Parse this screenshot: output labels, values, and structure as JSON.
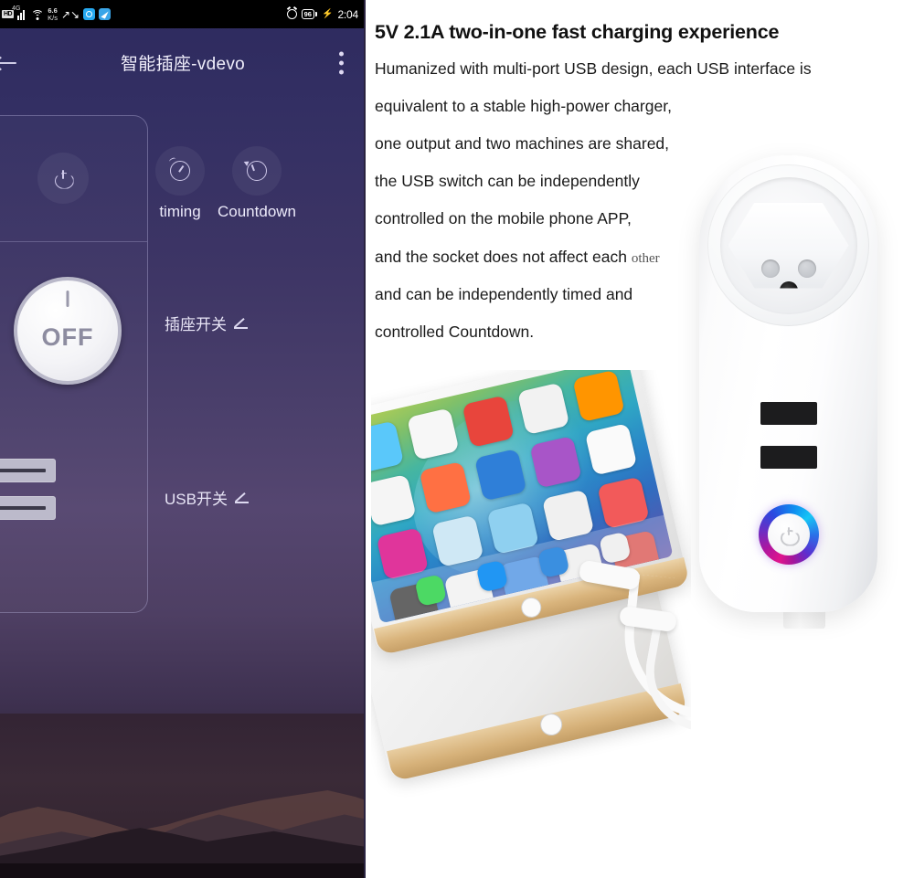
{
  "phone": {
    "statusbar": {
      "hd_badge": "HD",
      "network_type": "4G",
      "data_rate_value": "6.6",
      "data_rate_unit": "K/s",
      "battery_percent": "96",
      "time": "2:04",
      "icons": [
        "hd-icon",
        "signal-icon",
        "wifi-icon",
        "missed-call-icon",
        "app-icon-blue",
        "app-icon-cyan",
        "alarm-icon",
        "battery-icon",
        "charging-bolt-icon"
      ]
    },
    "appbar": {
      "title": "智能插座-vdevo",
      "back_icon": "back-arrow-icon",
      "menu_icon": "kebab-menu-icon"
    },
    "controls": {
      "power_icon": "power-icon",
      "knob_label": "OFF",
      "timing_label": "timing",
      "countdown_label": "Countdown",
      "socket_switch_label": "插座开关",
      "usb_switch_label": "USB开关",
      "edit_icon": "angle-edit-icon"
    }
  },
  "content": {
    "headline": "5V 2.1A two-in-one fast charging experience",
    "paragraph_lines": [
      "Humanized with multi-port USB design, each USB interface is",
      "equivalent to a stable high-power charger,",
      "one output and two machines are shared,",
      "the USB switch can be independently",
      " controlled on the mobile phone APP,",
      " and the socket does not affect each ",
      "and can be independently timed and",
      "controlled Countdown."
    ],
    "serif_word": "other"
  },
  "product": {
    "socket_label": "smart-socket-product-photo",
    "usb_port_count": 2,
    "led_ring_colors": [
      "#e0148c",
      "#2a49e0",
      "#17c6f5"
    ],
    "tablet_label": "tablets-charging-photo"
  },
  "colors": {
    "phone_bg_top": "#2d2a5e",
    "phone_bg_bottom": "#1a1119",
    "accent_text": "#eceafa",
    "knob_text": "#8d8ca0"
  }
}
